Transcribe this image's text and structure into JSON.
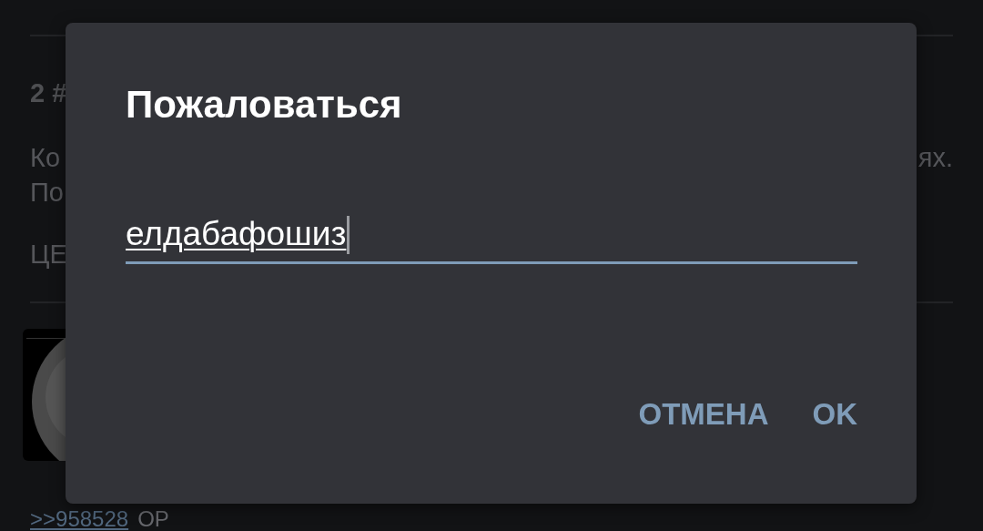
{
  "background": {
    "post_number": "2 #",
    "text_left_1": "Ко",
    "text_right_1": "ях.",
    "text_left_2": "По",
    "text_left_3": "ЦЕ",
    "reply_link": ">>958528",
    "reply_tag": "OP"
  },
  "dialog": {
    "title": "Пожаловаться",
    "input": {
      "value": "елдабафошиз",
      "focused": true
    },
    "buttons": [
      {
        "label": "ОТМЕНА"
      },
      {
        "label": "OK"
      }
    ]
  }
}
